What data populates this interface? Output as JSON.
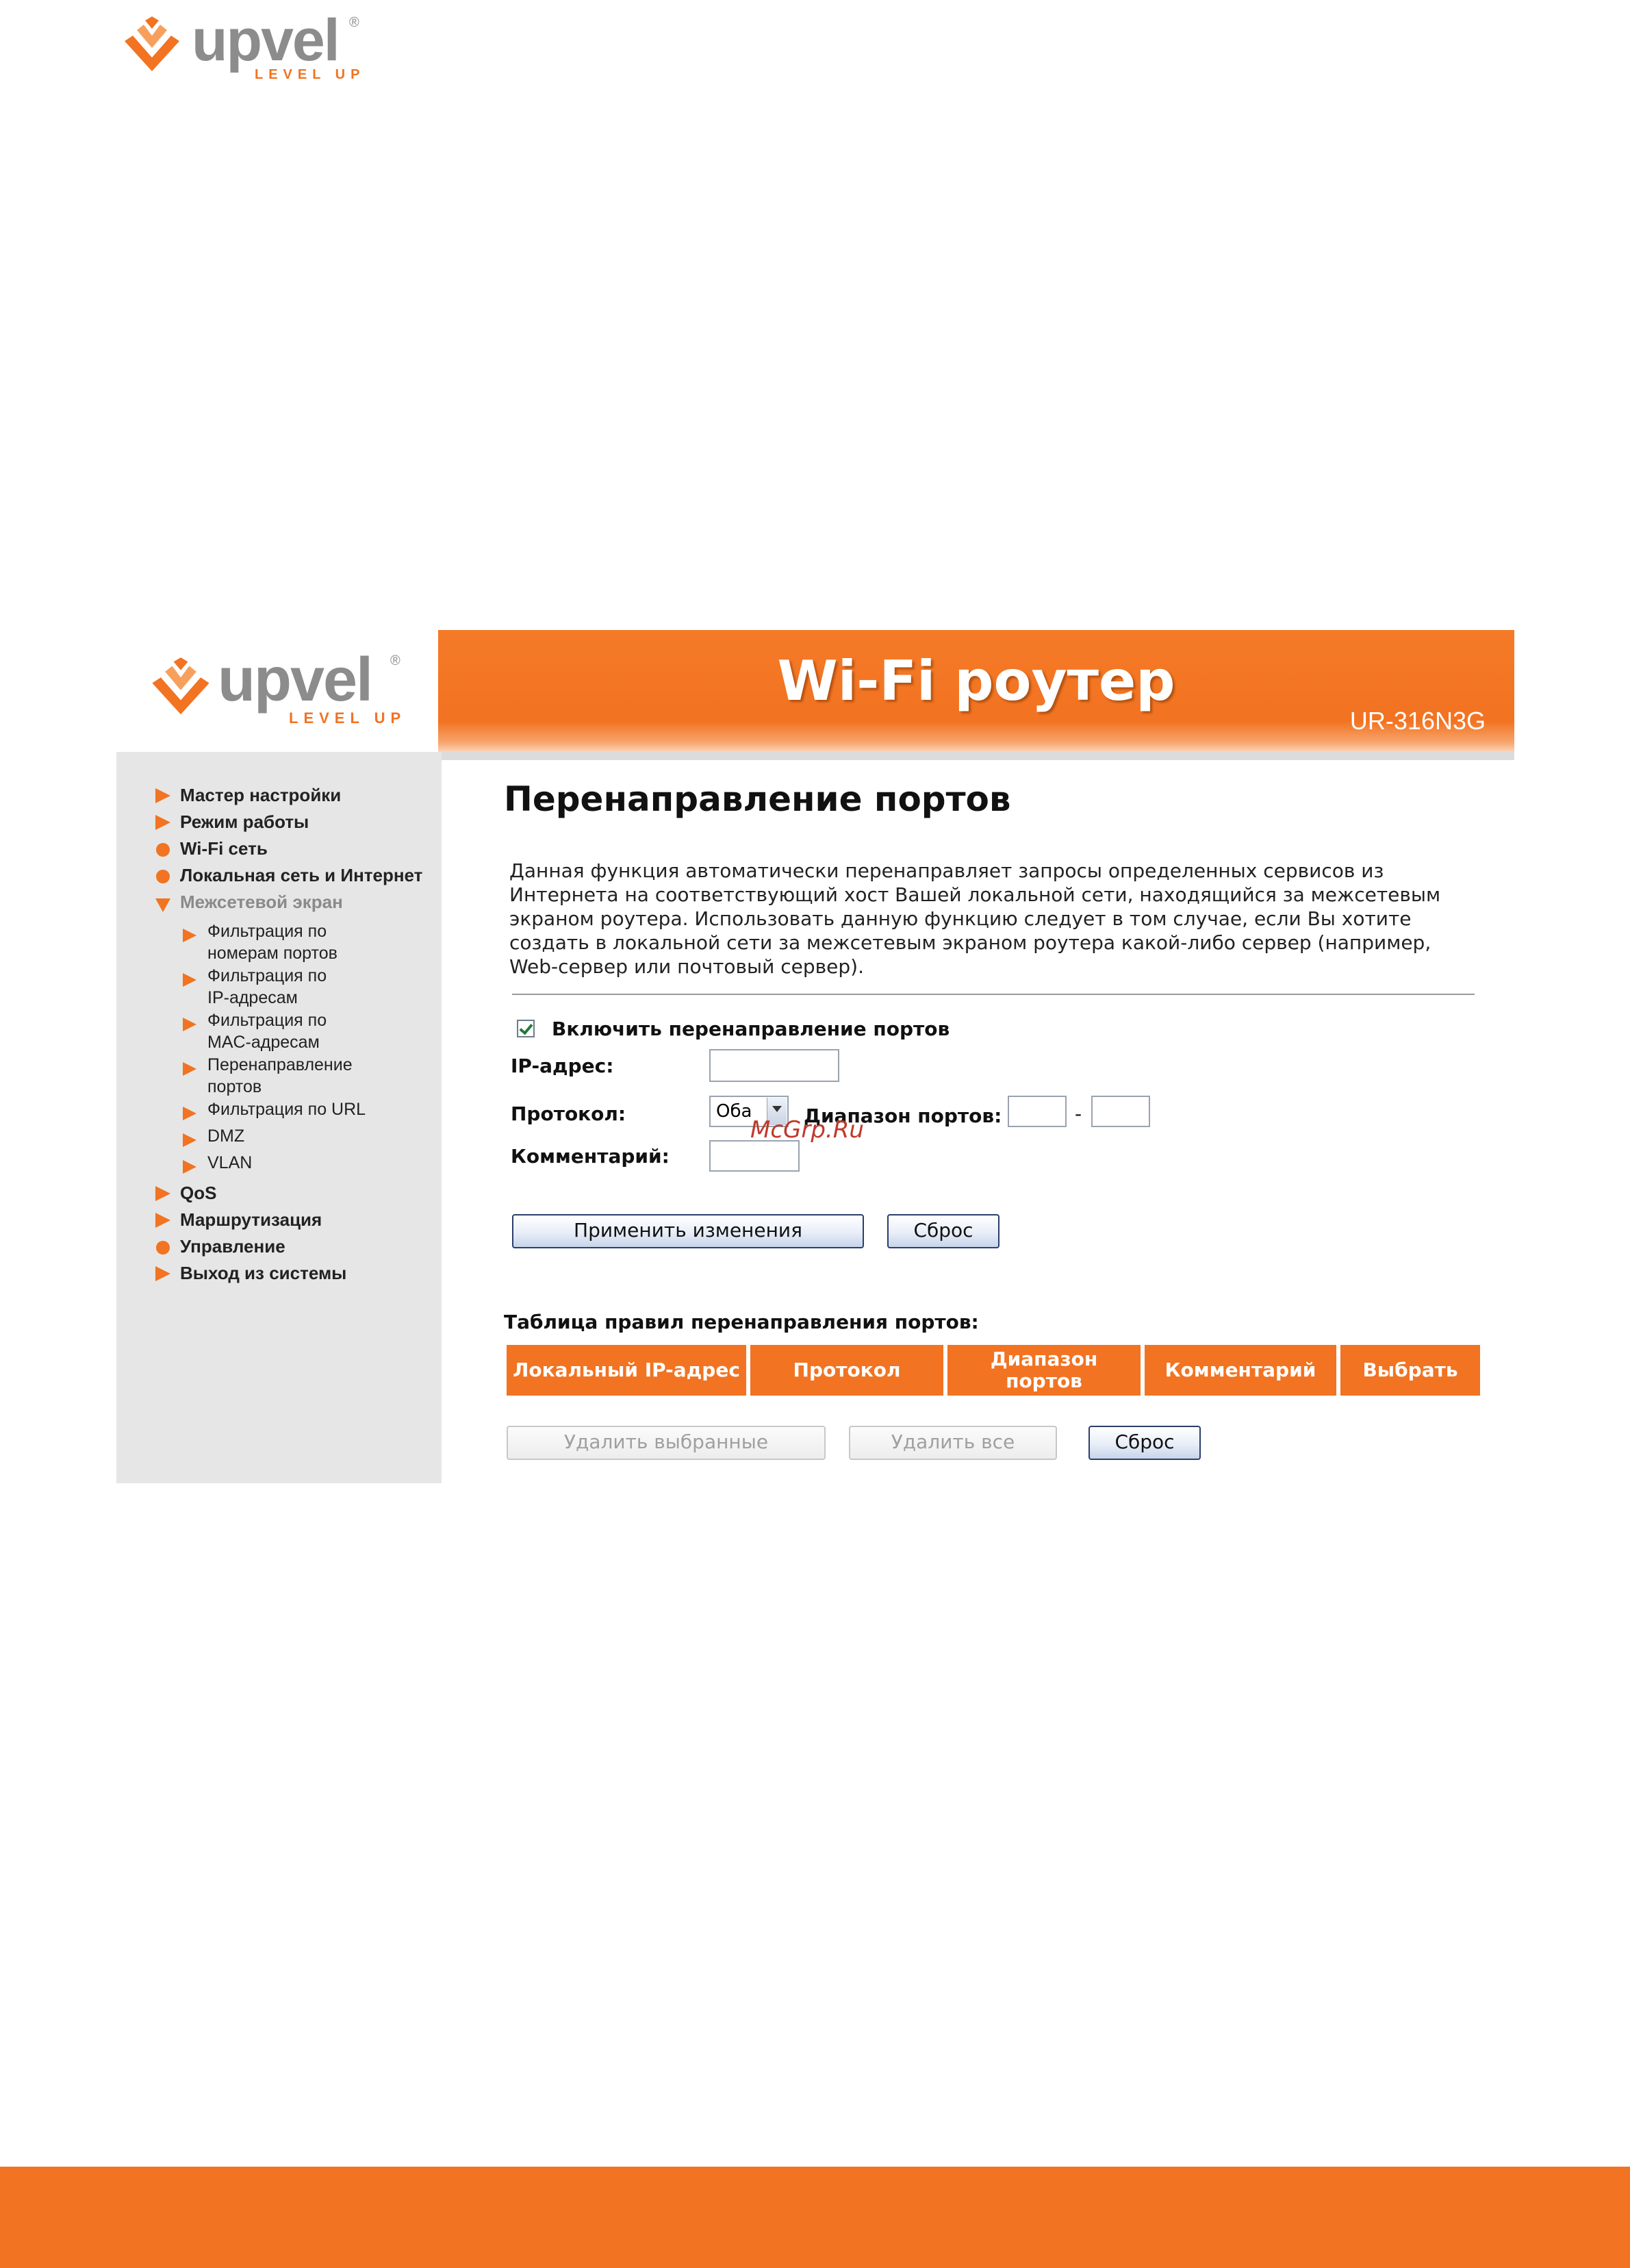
{
  "page": {
    "logo": {
      "wordmark": "upvel",
      "registered": "®",
      "tagline": "LEVEL UP"
    },
    "watermark": "McGrp.Ru"
  },
  "router_ui": {
    "header": {
      "logo": {
        "wordmark": "upvel",
        "registered": "®",
        "tagline": "LEVEL UP"
      },
      "title": "Wi-Fi роутер",
      "model": "UR-316N3G"
    },
    "sidebar": {
      "items": [
        {
          "label": "Мастер настройки",
          "marker": "arrow"
        },
        {
          "label": "Режим работы",
          "marker": "arrow"
        },
        {
          "label": "Wi-Fi сеть",
          "marker": "dot"
        },
        {
          "label": "Локальная сеть и Интернет",
          "marker": "dot"
        },
        {
          "label": "Межсетевой экран",
          "marker": "arrow-down",
          "state": "expanded"
        },
        {
          "label": "QoS",
          "marker": "arrow"
        },
        {
          "label": "Маршрутизация",
          "marker": "arrow"
        },
        {
          "label": "Управление",
          "marker": "dot"
        },
        {
          "label": "Выход из системы",
          "marker": "arrow"
        }
      ],
      "firewall_subitems": [
        {
          "line1": "Фильтрация по",
          "line2": "номерам портов"
        },
        {
          "line1": "Фильтрация по",
          "line2": "IP-адресам"
        },
        {
          "line1": "Фильтрация по",
          "line2": "MAC-адресам"
        },
        {
          "line1": "Перенаправление",
          "line2": "портов"
        },
        {
          "line1": "Фильтрация по URL",
          "line2": ""
        },
        {
          "line1": "DMZ",
          "line2": ""
        },
        {
          "line1": "VLAN",
          "line2": ""
        }
      ]
    },
    "main": {
      "title": "Перенаправление портов",
      "description": "Данная функция автоматически перенаправляет запросы определенных сервисов из Интернета на соответствующий хост Вашей локальной сети, находящийся за межсетевым экраном роутера. Использовать данную функцию следует в том случае, если Вы хотите создать в локальной сети за межсетевым экраном роутера какой-либо сервер (например, Web-сервер или почтовый сервер).",
      "enable_label": "Включить перенаправление портов",
      "enable_checked": true,
      "ip_label": "IP-адрес:",
      "ip_value": "",
      "protocol_label": "Протокол:",
      "protocol_value": "Оба",
      "port_range_label": "Диапазон портов:",
      "port_from": "",
      "port_dash": "-",
      "port_to": "",
      "comment_label": "Комментарий:",
      "comment_value": "",
      "apply_button": "Применить изменения",
      "reset_button": "Сброс",
      "table_title": "Таблица правил перенаправления портов:",
      "table_headers": [
        "Локальный IP-адрес",
        "Протокол",
        "Диапазон портов",
        "Комментарий",
        "Выбрать"
      ],
      "table_header_lines": {
        "range_line1": "Диапазон",
        "range_line2": "портов"
      },
      "delete_selected_button": "Удалить выбранные",
      "delete_all_button": "Удалить все",
      "table_reset_button": "Сброс"
    }
  },
  "colors": {
    "accent": "#f27321",
    "sidebar_bg": "#e6e6e6",
    "logo_grey": "#8c8c8c"
  }
}
